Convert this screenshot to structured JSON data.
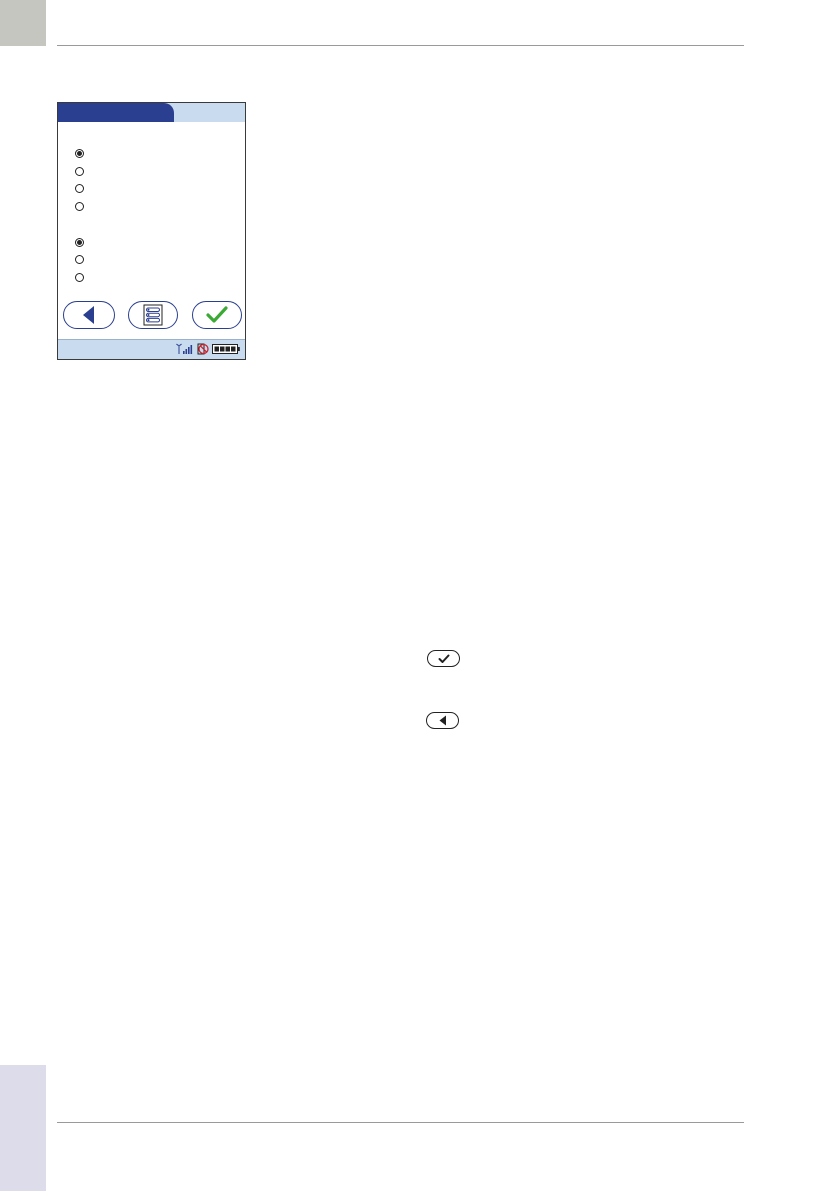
{
  "page": {
    "page_number": "",
    "colors": {
      "rule": "#9a9a9a",
      "corner_tab": "#c6c6c0",
      "side_tab": "#dcdcea"
    }
  },
  "screen": {
    "title": "",
    "colors": {
      "title_tab": "#2a3f8f",
      "bars": "#c9dcef",
      "ok_check": "#3aaa35",
      "back_arrow": "#2a3f8f"
    },
    "radio_group_1": [
      {
        "label": "",
        "selected": true
      },
      {
        "label": "",
        "selected": false
      },
      {
        "label": "",
        "selected": false
      },
      {
        "label": "",
        "selected": false
      }
    ],
    "radio_group_2": [
      {
        "label": "",
        "selected": true
      },
      {
        "label": "",
        "selected": false
      },
      {
        "label": "",
        "selected": false
      }
    ],
    "buttons": {
      "back": "back-arrow-icon",
      "menu": "list-menu-icon",
      "ok": "checkmark-icon"
    },
    "status_icons": [
      "wireless-signal-icon",
      "no-connection-icon",
      "battery-icon"
    ]
  },
  "inline_icons": {
    "ok": "checkmark-button-icon",
    "back": "back-button-icon"
  }
}
